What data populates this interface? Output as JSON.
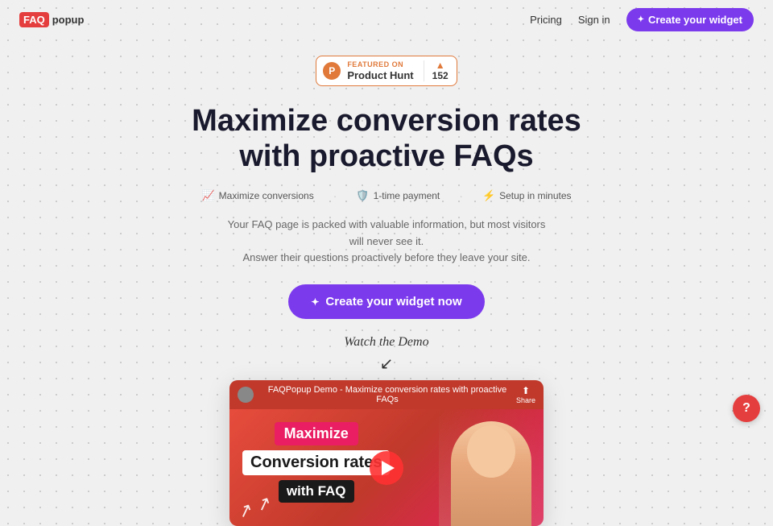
{
  "brand": {
    "faq_label": "FAQ",
    "popup_label": "popup"
  },
  "nav": {
    "pricing_label": "Pricing",
    "signin_label": "Sign in",
    "cta_label": "Create your widget"
  },
  "product_hunt": {
    "featured_label": "FEATURED ON",
    "name": "Product Hunt",
    "count": "152",
    "arrow": "▲"
  },
  "hero": {
    "title_line1": "Maximize conversion rates",
    "title_line2": "with proactive FAQs",
    "features": [
      {
        "icon": "📈",
        "label": "Maximize conversions"
      },
      {
        "icon": "🛡️",
        "label": "1-time payment"
      },
      {
        "icon": "⚡",
        "label": "Setup in minutes"
      }
    ],
    "subtext_line1": "Your FAQ page is packed with valuable information, but most visitors will never see it.",
    "subtext_line2": "Answer their questions proactively before they leave your site.",
    "cta_label": "Create your widget now",
    "watch_demo": "Watch the Demo"
  },
  "video": {
    "title": "FAQPopup Demo - Maximize conversion rates with proactive FAQs",
    "share_label": "Share",
    "line1": "Maximize",
    "line2": "Conversion rates",
    "line3": "with FAQ"
  },
  "help": {
    "label": "?"
  }
}
